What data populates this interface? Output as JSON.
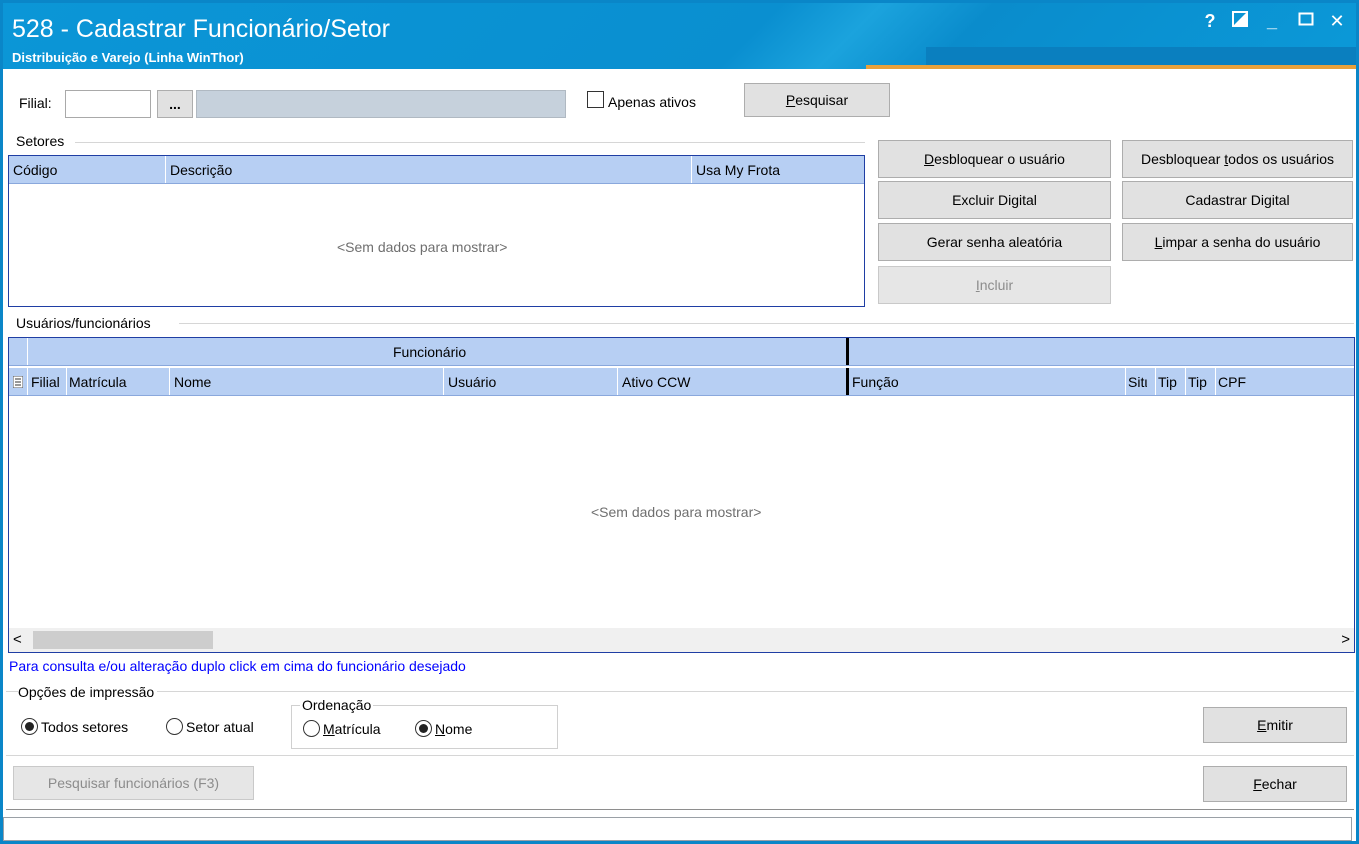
{
  "window": {
    "title": "528 - Cadastrar Funcionário/Setor",
    "subtitle": "Distribuição e Varejo (Linha WinThor)",
    "controls": [
      "?",
      "◩",
      "_",
      "☐",
      "✕"
    ]
  },
  "filter": {
    "filial_label": "Filial:",
    "filial_value": "",
    "lookup_button": "...",
    "filial_description": "",
    "apenas_ativos_label": "Apenas ativos",
    "apenas_ativos_checked": false,
    "pesquisar_prefix": "P",
    "pesquisar_rest": "esquisar"
  },
  "setores": {
    "group_label": "Setores",
    "columns": [
      "Código",
      "Descrição",
      "Usa My Frota"
    ],
    "empty_text": "<Sem dados para mostrar>"
  },
  "actions": {
    "desbloquear_prefix": "D",
    "desbloquear_rest": "esbloquear o usuário",
    "desbloquear_todos_a": "Desbloquear ",
    "desbloquear_todos_u": "t",
    "desbloquear_todos_b": "odos os usuários",
    "excluir_digital": "Excluir Digital",
    "cadastrar_digital": "Cadastrar Digital",
    "gerar_senha": "Gerar senha aleatória",
    "limpar_prefix": "L",
    "limpar_rest": "impar a senha do usuário",
    "incluir_prefix": "I",
    "incluir_rest": "ncluir"
  },
  "usuarios": {
    "group_label": "Usuários/funcionários",
    "band_label": "Funcionário",
    "columns": [
      "Filial",
      "Matrícula",
      "Nome",
      "Usuário",
      "Ativo CCW",
      "Função",
      "Sitι",
      "Tip",
      "Tip",
      "CPF"
    ],
    "empty_text": "<Sem dados para mostrar>",
    "hint": "Para consulta e/ou alteração duplo click em cima do funcionário desejado",
    "hint_color": "#0000ff"
  },
  "impressao": {
    "group_label": "Opções de impressão",
    "todos_setores": "Todos setores",
    "setor_atual": "Setor atual",
    "selected": "Todos setores",
    "ordenacao_label": "Ordenação",
    "matricula_prefix": "M",
    "matricula_rest": "atrícula",
    "nome_prefix": "N",
    "nome_rest": "ome",
    "ordenacao_selected": "Nome",
    "emitir_prefix": "E",
    "emitir_rest": "mitir"
  },
  "footer": {
    "pesquisar_funcionarios": "Pesquisar funcionários (F3)",
    "fechar_prefix": "F",
    "fechar_rest": "echar"
  }
}
